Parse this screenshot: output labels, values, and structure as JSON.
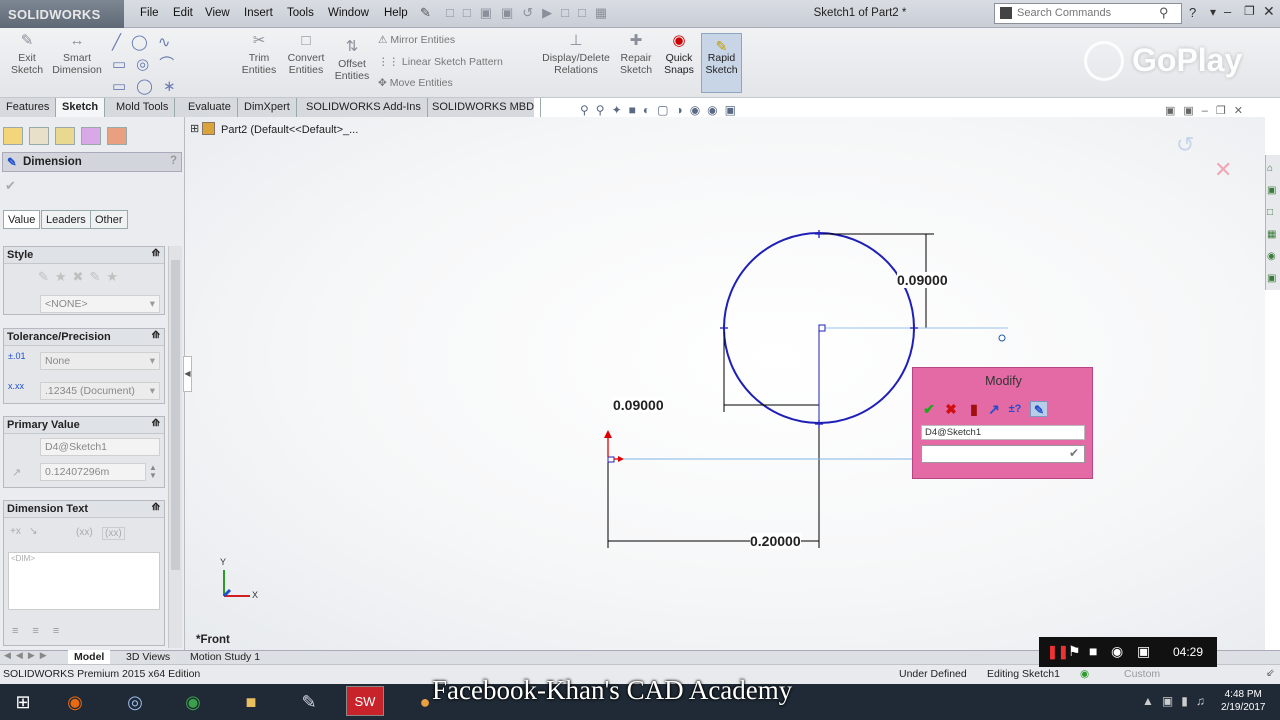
{
  "app": {
    "logo": "SOLIDWORKS",
    "document_title": "Sketch1 of Part2 *"
  },
  "menu": [
    "File",
    "Edit",
    "View",
    "Insert",
    "Tools",
    "Window",
    "Help"
  ],
  "search": {
    "placeholder": "Search Commands"
  },
  "commands": {
    "exit_sketch": "Exit Sketch",
    "smart_dimension": "Smart Dimension",
    "trim_entities": "Trim Entities",
    "convert_entities": "Convert Entities",
    "offset_entities": "Offset Entities",
    "mirror_entities": "Mirror Entities",
    "linear_pattern": "Linear Sketch Pattern",
    "move_entities": "Move Entities",
    "display_relations": "Display/Delete Relations",
    "repair_sketch": "Repair Sketch",
    "quick_snaps": "Quick Snaps",
    "rapid_sketch": "Rapid Sketch"
  },
  "command_tabs": [
    "Features",
    "Sketch",
    "Mold Tools",
    "Evaluate",
    "DimXpert",
    "SOLIDWORKS Add-Ins",
    "SOLIDWORKS MBD"
  ],
  "active_command_tab": "Sketch",
  "tree": {
    "part_label": "Part2  (Default<<Default>_..."
  },
  "property_manager": {
    "title": "Dimension",
    "tabs": [
      "Value",
      "Leaders",
      "Other"
    ],
    "style": {
      "header": "Style",
      "selection": "<NONE>"
    },
    "tolerance": {
      "header": "Tolerance/Precision",
      "type": "None",
      "precision": ".12345 (Document)"
    },
    "primary": {
      "header": "Primary Value",
      "name": "D4@Sketch1",
      "value": "0.12407296m"
    },
    "dim_text": {
      "header": "Dimension Text",
      "token": "<DIM>",
      "tokens": "(xx)"
    }
  },
  "sketch": {
    "dim_diameter": "0.09000",
    "dim_horizontal": "0.09000",
    "dim_bottom": "0.20000",
    "view_label": "*Front",
    "axis_x": "X",
    "axis_y": "Y"
  },
  "modify": {
    "title": "Modify",
    "name_field": "D4@Sketch1",
    "value": ""
  },
  "bottom_tabs": [
    "Model",
    "3D Views",
    "Motion Study 1"
  ],
  "status": {
    "edition": "SOLIDWORKS Premium 2015 x64 Edition",
    "state": "Under Defined",
    "mode": "Editing Sketch1",
    "custom": "Custom"
  },
  "overlay": {
    "watermark": "Facebook-Khan's CAD Academy",
    "timer": "04:29",
    "goplay": "GoPlay"
  },
  "taskbar": {
    "time": "4:48 PM",
    "date": "2/19/2017"
  },
  "colors": {
    "sketch_blue": "#1f1fb8",
    "modify_bg": "#e36aa5",
    "accent": "#0a64c8"
  }
}
